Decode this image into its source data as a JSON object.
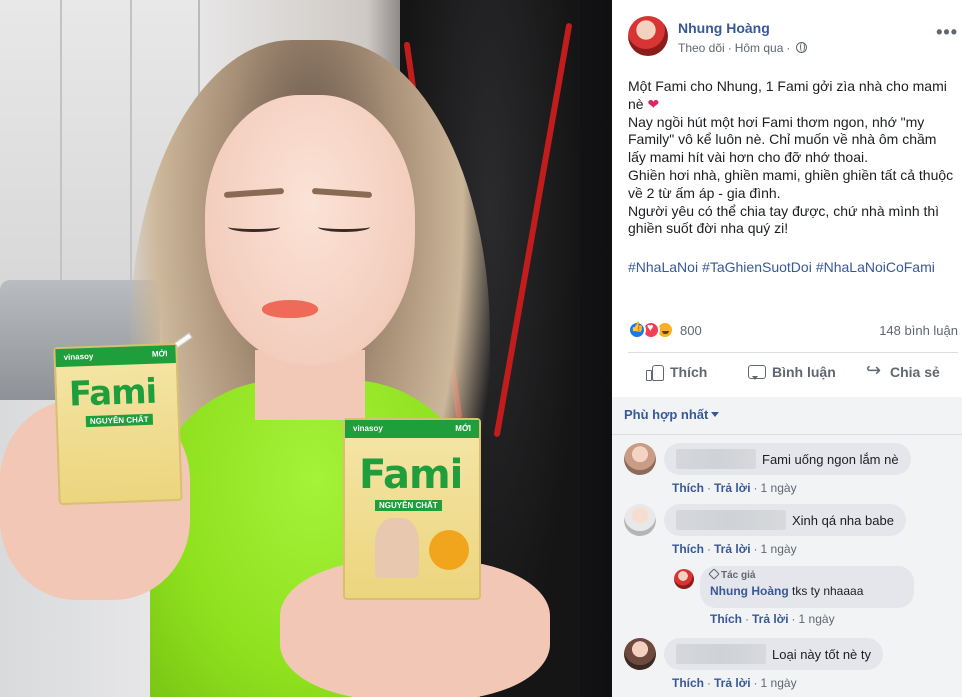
{
  "post": {
    "author": "Nhung Hoàng",
    "follow_label": "Theo dõi",
    "time": "Hôm qua",
    "more_label": "•••",
    "body_lines": [
      "Một Fami cho Nhung, 1 Fami gởi zìa nhà cho mami nè",
      "Nay ngồi hút một hơi Fami thơm ngon, nhớ \"my Family\" vô kể luôn nè. Chỉ muốn về nhà ôm chầm lấy mami hít vài hơn cho đỡ nhớ thoai.",
      "Ghiền hơi nhà, ghiền mami, ghiền ghiền tất cả thuộc về 2 từ ấm áp - gia đình.",
      "Người yêu có thể chia tay được, chứ nhà mình thì ghiền suốt đời nha quý zi!"
    ],
    "hashtags": [
      "#NhaLaNoi",
      "#TaGhienSuotDoi",
      "#NhaLaNoiCoFami"
    ],
    "reaction_count": "800",
    "comment_count": "148 bình luận",
    "actions": {
      "like": "Thích",
      "comment": "Bình luận",
      "share": "Chia sẻ"
    },
    "sort_label": "Phù hợp nhất"
  },
  "photo": {
    "box_brand": "Fami",
    "box_subtitle": "NGUYÊN CHẤT",
    "box_small_brand": "vinasoy",
    "box_new": "MỚI"
  },
  "comments": [
    {
      "text": "Fami uống ngon lắm nè",
      "like": "Thích",
      "reply": "Trả lời",
      "time": "1 ngày"
    },
    {
      "text": "Xinh qá nha babe",
      "like": "Thích",
      "reply": "Trả lời",
      "time": "1 ngày"
    },
    {
      "text": "Loại này tốt nè ty",
      "like": "Thích",
      "reply": "Trả lời",
      "time": "1 ngày"
    }
  ],
  "reply": {
    "badge": "Tác giả",
    "name": "Nhung Hoàng",
    "text": "tks ty nhaaaa",
    "like": "Thích",
    "reply": "Trả lời",
    "time": "1 ngày"
  },
  "colors": {
    "link": "#385898",
    "like_react": "#1877f2",
    "love_react": "#f33e58",
    "haha_react": "#f7b125",
    "brand_green": "#1f9e3c",
    "top_green": "#8fe11e"
  },
  "icons": [
    "globe-icon",
    "heart-icon",
    "thumb-icon",
    "comment-icon",
    "share-icon",
    "pen-icon"
  ]
}
